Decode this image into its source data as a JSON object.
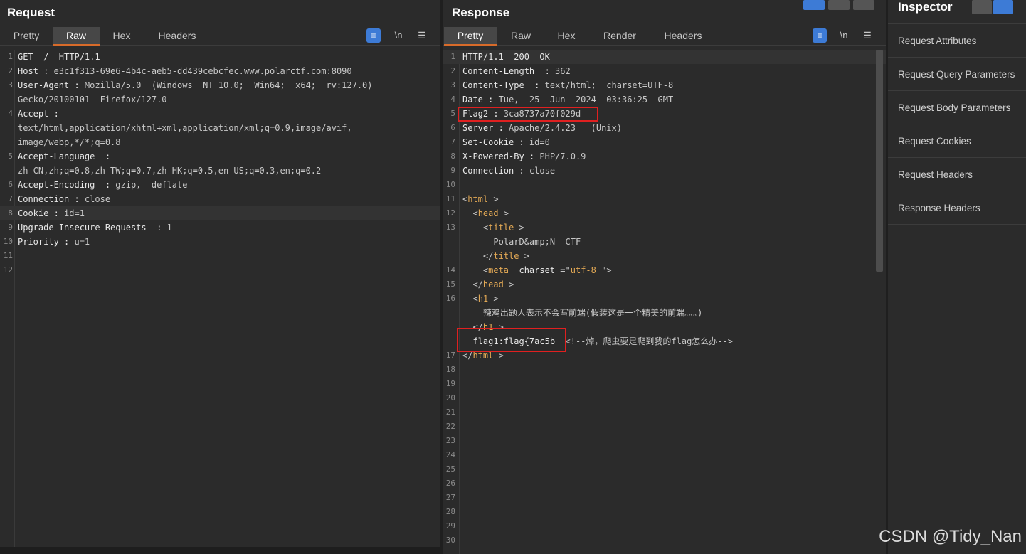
{
  "request": {
    "title": "Request",
    "tabs": [
      "Pretty",
      "Raw",
      "Hex",
      "Headers"
    ],
    "active_tab": "Raw",
    "newline_label": "\\n",
    "lines": [
      {
        "n": "1",
        "k": "GET  /  HTTP/1.1",
        "v": ""
      },
      {
        "n": "2",
        "k": "Host :",
        "v": " e3c1f313-69e6-4b4c-aeb5-dd439cebcfec.www.polarctf.com:8090"
      },
      {
        "n": "3",
        "k": "User-Agent :",
        "v": " Mozilla/5.0  (Windows  NT 10.0;  Win64;  x64;  rv:127.0)"
      },
      {
        "n": "",
        "k": "",
        "v": "Gecko/20100101  Firefox/127.0"
      },
      {
        "n": "4",
        "k": "Accept :",
        "v": ""
      },
      {
        "n": "",
        "k": "",
        "v": "text/html,application/xhtml+xml,application/xml;q=0.9,image/avif,"
      },
      {
        "n": "",
        "k": "",
        "v": "image/webp,*/*;q=0.8"
      },
      {
        "n": "5",
        "k": "Accept-Language  :",
        "v": ""
      },
      {
        "n": "",
        "k": "",
        "v": "zh-CN,zh;q=0.8,zh-TW;q=0.7,zh-HK;q=0.5,en-US;q=0.3,en;q=0.2"
      },
      {
        "n": "6",
        "k": "Accept-Encoding  :",
        "v": " gzip,  deflate"
      },
      {
        "n": "7",
        "k": "Connection :",
        "v": " close"
      },
      {
        "n": "8",
        "k": "Cookie :",
        "v": " id=1"
      },
      {
        "n": "9",
        "k": "Upgrade-Insecure-Requests  :",
        "v": " 1"
      },
      {
        "n": "10",
        "k": "Priority :",
        "v": " u=1"
      },
      {
        "n": "11",
        "k": "",
        "v": ""
      },
      {
        "n": "12",
        "k": "",
        "v": ""
      }
    ]
  },
  "response": {
    "title": "Response",
    "tabs": [
      "Pretty",
      "Raw",
      "Hex",
      "Render",
      "Headers"
    ],
    "active_tab": "Pretty",
    "newline_label": "\\n",
    "lines": [
      {
        "n": "1",
        "parts": [
          [
            "k",
            "HTTP/1.1  200  OK"
          ]
        ]
      },
      {
        "n": "2",
        "parts": [
          [
            "k",
            "Content-Length  :"
          ],
          [
            "v",
            " 362"
          ]
        ]
      },
      {
        "n": "3",
        "parts": [
          [
            "k",
            "Content-Type  :"
          ],
          [
            "v",
            " text/html;  charset=UTF-8"
          ]
        ]
      },
      {
        "n": "4",
        "parts": [
          [
            "k",
            "Date :"
          ],
          [
            "v",
            " Tue,  25  Jun  2024  03:36:25  GMT"
          ]
        ]
      },
      {
        "n": "5",
        "parts": [
          [
            "k",
            "Flag2 :"
          ],
          [
            "v",
            " 3ca8737a70f029d"
          ]
        ]
      },
      {
        "n": "6",
        "parts": [
          [
            "k",
            "Server :"
          ],
          [
            "v",
            " Apache/2.4.23   (Unix)"
          ]
        ]
      },
      {
        "n": "7",
        "parts": [
          [
            "k",
            "Set-Cookie :"
          ],
          [
            "v",
            " id=0"
          ]
        ]
      },
      {
        "n": "8",
        "parts": [
          [
            "k",
            "X-Powered-By :"
          ],
          [
            "v",
            " PHP/7.0.9"
          ]
        ]
      },
      {
        "n": "9",
        "parts": [
          [
            "k",
            "Connection :"
          ],
          [
            "v",
            " close"
          ]
        ]
      },
      {
        "n": "10",
        "parts": []
      },
      {
        "n": "11",
        "parts": [
          [
            "v",
            "<"
          ],
          [
            "tag",
            "html"
          ],
          [
            "v",
            " >"
          ]
        ]
      },
      {
        "n": "12",
        "parts": [
          [
            "v",
            "  <"
          ],
          [
            "tag",
            "head"
          ],
          [
            "v",
            " >"
          ]
        ]
      },
      {
        "n": "13",
        "parts": [
          [
            "v",
            "    <"
          ],
          [
            "tag",
            "title"
          ],
          [
            "v",
            " >"
          ]
        ]
      },
      {
        "n": "",
        "parts": [
          [
            "v",
            "      PolarD&amp;N  CTF"
          ]
        ]
      },
      {
        "n": "",
        "parts": [
          [
            "v",
            "    </"
          ],
          [
            "tag",
            "title"
          ],
          [
            "v",
            " >"
          ]
        ]
      },
      {
        "n": "14",
        "parts": [
          [
            "v",
            "    <"
          ],
          [
            "tag",
            "meta"
          ],
          [
            "v",
            "  "
          ],
          [
            "k",
            "charset"
          ],
          [
            "v",
            " =\""
          ],
          [
            "tag",
            "utf-8"
          ],
          [
            "v",
            " \">"
          ]
        ]
      },
      {
        "n": "15",
        "parts": [
          [
            "v",
            "  </"
          ],
          [
            "tag",
            "head"
          ],
          [
            "v",
            " >"
          ]
        ]
      },
      {
        "n": "16",
        "parts": [
          [
            "v",
            "  <"
          ],
          [
            "tag",
            "h1"
          ],
          [
            "v",
            " >"
          ]
        ]
      },
      {
        "n": "",
        "parts": [
          [
            "v",
            "    辣鸡出题人表示不会写前端(假装这是一个精美的前端。。。)"
          ]
        ]
      },
      {
        "n": "",
        "parts": [
          [
            "v",
            "  </"
          ],
          [
            "tag",
            "h1"
          ],
          [
            "v",
            " >"
          ]
        ]
      },
      {
        "n": "",
        "parts": [
          [
            "k",
            "  flag1:flag{7ac5b"
          ],
          [
            "v",
            "  <!--焯，爬虫要是爬到我的flag怎么办-->"
          ]
        ]
      },
      {
        "n": "17",
        "parts": [
          [
            "v",
            "</"
          ],
          [
            "tag",
            "html"
          ],
          [
            "v",
            " >"
          ]
        ]
      },
      {
        "n": "18",
        "parts": []
      },
      {
        "n": "19",
        "parts": []
      },
      {
        "n": "20",
        "parts": []
      },
      {
        "n": "21",
        "parts": []
      },
      {
        "n": "22",
        "parts": []
      },
      {
        "n": "23",
        "parts": []
      },
      {
        "n": "24",
        "parts": []
      },
      {
        "n": "25",
        "parts": []
      },
      {
        "n": "26",
        "parts": []
      },
      {
        "n": "27",
        "parts": []
      },
      {
        "n": "28",
        "parts": []
      },
      {
        "n": "29",
        "parts": []
      },
      {
        "n": "30",
        "parts": []
      }
    ]
  },
  "inspector": {
    "title": "Inspector",
    "items": [
      "Request Attributes",
      "Request Query Parameters",
      "Request Body Parameters",
      "Request Cookies",
      "Request Headers",
      "Response Headers"
    ]
  },
  "watermark": "CSDN @Tidy_Nan",
  "colors": {
    "accent": "#3d7bd6",
    "highlight_box": "#e02020",
    "tab_underline": "#d86b2a",
    "tag": "#e3a955"
  }
}
